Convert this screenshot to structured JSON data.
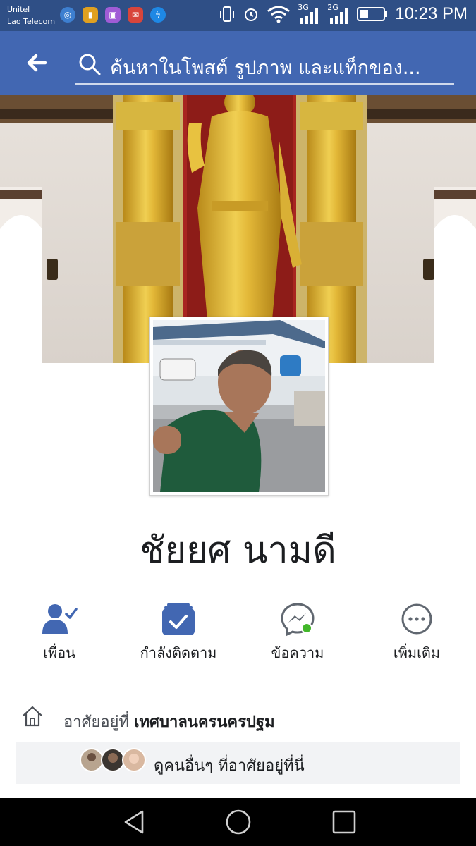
{
  "status_bar": {
    "carrier_line1": "Unitel",
    "carrier_line2": "Lao Telecom",
    "network_3g": "3G",
    "network_2g": "2G",
    "time": "10:23 PM"
  },
  "header": {
    "search_placeholder": "ค้นหาในโพสต์ รูปภาพ และแท็กของ..."
  },
  "profile": {
    "name": "ชัยยศ นามดี"
  },
  "actions": [
    {
      "label": "เพื่อน",
      "icon": "friends-check-icon"
    },
    {
      "label": "กำลังติดตาม",
      "icon": "following-check-icon"
    },
    {
      "label": "ข้อความ",
      "icon": "messenger-icon"
    },
    {
      "label": "เพิ่มเติม",
      "icon": "more-icon"
    }
  ],
  "details": {
    "lives_in_prefix": "อาศัยอยู่ที่",
    "lives_in_place": "เทศบาลนครนครปฐม",
    "see_others": "ดูคนอื่นๆ ที่อาศัยอยู่ที่นี่"
  },
  "colors": {
    "header_bg": "#4267b2",
    "status_bg": "#2f4f86",
    "accent_blue": "#4267b2",
    "online_green": "#42b72a"
  }
}
